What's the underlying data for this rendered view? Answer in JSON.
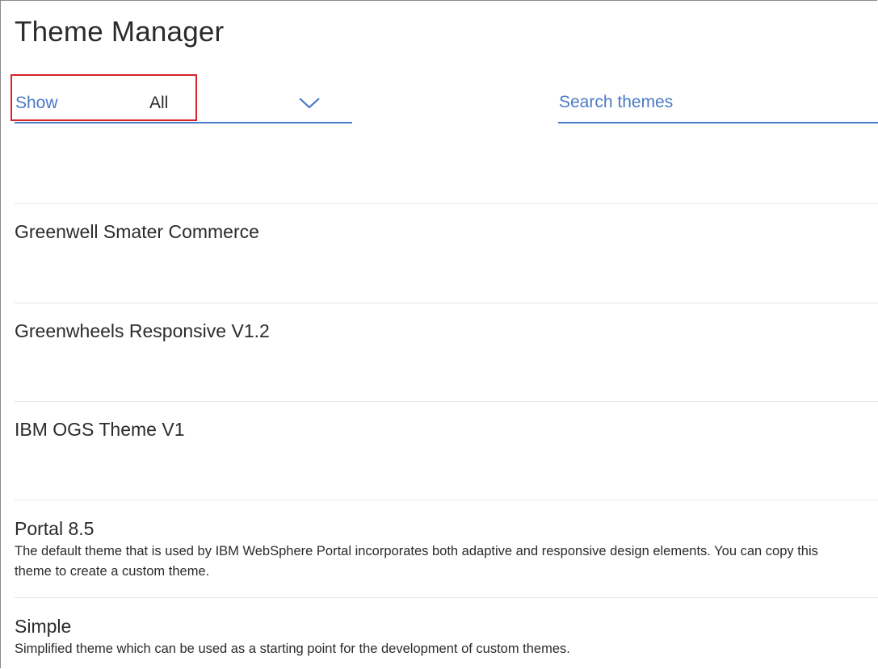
{
  "header": {
    "title": "Theme Manager"
  },
  "filter": {
    "label": "Show",
    "value": "All",
    "icon": "chevron-down-icon"
  },
  "search": {
    "placeholder": "Search themes",
    "value": ""
  },
  "colors": {
    "accent": "#4a7ac7",
    "highlight": "#d8232a",
    "divider": "#e6e6e6",
    "text": "#2b2b2b"
  },
  "themes": [
    {
      "name": "Greenwell Smater Commerce",
      "description": ""
    },
    {
      "name": "Greenwheels Responsive V1.2",
      "description": ""
    },
    {
      "name": "IBM OGS Theme V1",
      "description": ""
    },
    {
      "name": "Portal 8.5",
      "description": "The default theme that is used by IBM WebSphere Portal incorporates both adaptive and responsive design elements. You can copy this theme to create a custom theme."
    },
    {
      "name": "Simple",
      "description": "Simplified theme which can be used as a starting point for the development of custom themes."
    }
  ]
}
